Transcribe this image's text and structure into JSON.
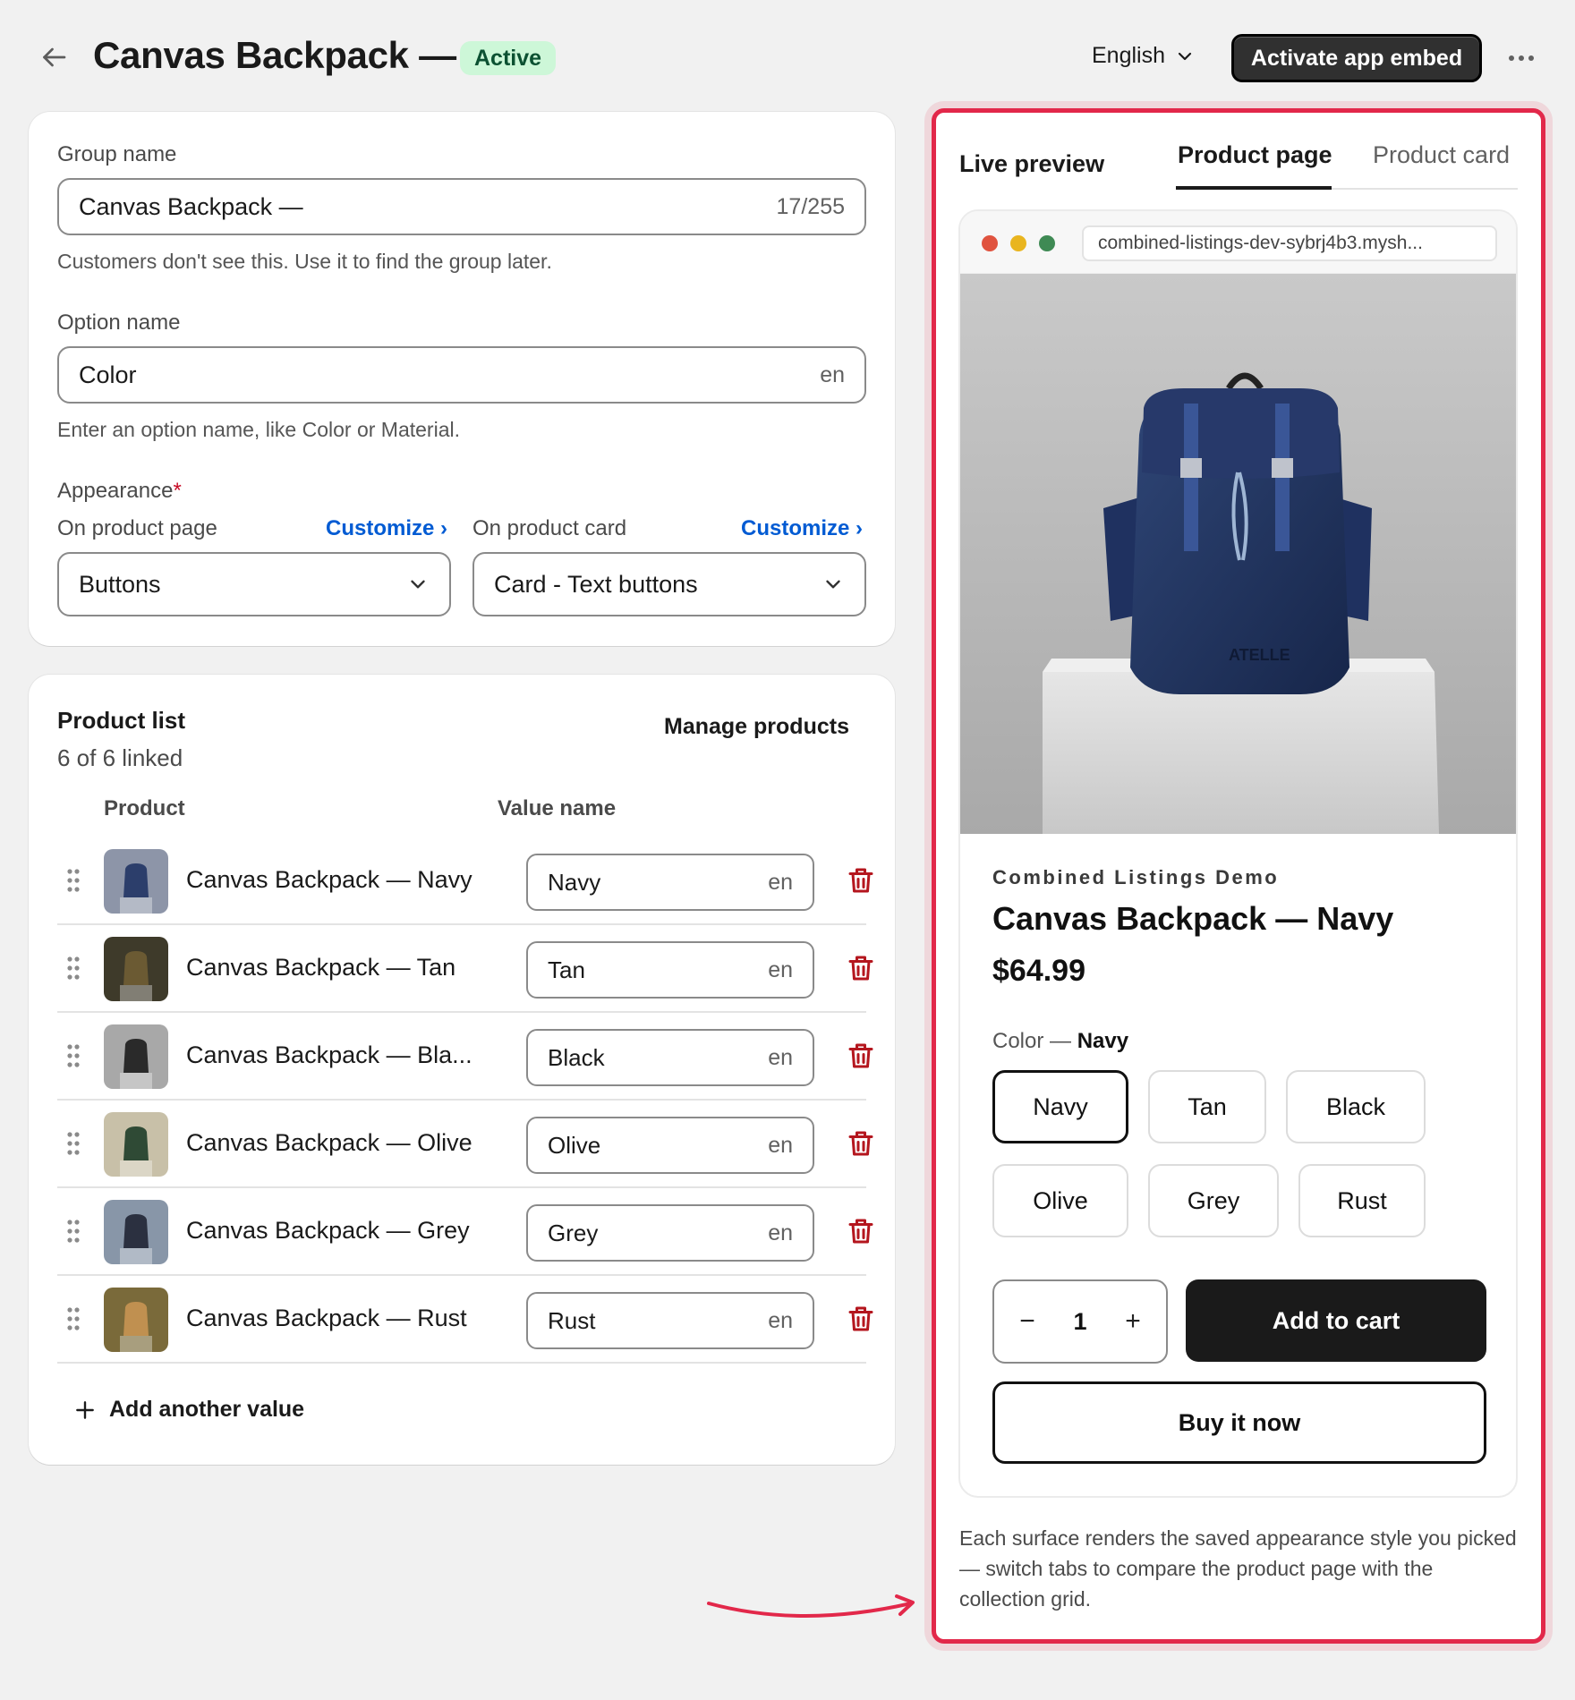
{
  "header": {
    "title": "Canvas Backpack —",
    "status": "Active",
    "language": "English",
    "embed_button": "Activate app embed"
  },
  "group": {
    "name_label": "Group name",
    "name_value": "Canvas Backpack —",
    "name_counter": "17/255",
    "name_help": "Customers don't see this. Use it to find the group later.",
    "option_label": "Option name",
    "option_value": "Color",
    "option_locale": "en",
    "option_help": "Enter an option name, like Color or Material.",
    "appearance_label": "Appearance",
    "appearance_required": "*",
    "product_page_label": "On product page",
    "product_card_label": "On product card",
    "customize_label": "Customize ›",
    "product_page_value": "Buttons",
    "product_card_value": "Card - Text buttons"
  },
  "product_list": {
    "title": "Product list",
    "subtitle": "6 of 6 linked",
    "manage": "Manage products",
    "col_product": "Product",
    "col_value": "Value name",
    "add_value": "Add another value",
    "items": [
      {
        "name": "Canvas Backpack — Navy",
        "value": "Navy",
        "locale": "en"
      },
      {
        "name": "Canvas Backpack — Tan",
        "value": "Tan",
        "locale": "en"
      },
      {
        "name": "Canvas Backpack — Bla...",
        "value": "Black",
        "locale": "en"
      },
      {
        "name": "Canvas Backpack — Olive",
        "value": "Olive",
        "locale": "en"
      },
      {
        "name": "Canvas Backpack — Grey",
        "value": "Grey",
        "locale": "en"
      },
      {
        "name": "Canvas Backpack — Rust",
        "value": "Rust",
        "locale": "en"
      }
    ]
  },
  "preview": {
    "title": "Live preview",
    "tabs": [
      "Product page",
      "Product card"
    ],
    "url": "combined-listings-dev-sybrj4b3.mysh...",
    "brand_watermark": "ATELLE",
    "vendor": "Combined Listings Demo",
    "product_title": "Canvas Backpack — Navy",
    "price": "$64.99",
    "option_name": "Color —",
    "option_selected": "Navy",
    "swatches": [
      "Navy",
      "Tan",
      "Black",
      "Olive",
      "Grey",
      "Rust"
    ],
    "qty_minus": "−",
    "qty_value": "1",
    "qty_plus": "+",
    "add_to_cart": "Add to cart",
    "buy_now": "Buy it now",
    "note": "Each surface renders the saved appearance style you picked — switch tabs to compare the product page with the collection grid."
  },
  "colors": {
    "accent_link": "#005bd3",
    "status_bg": "#cdf7d8",
    "highlight": "#e2284a",
    "delete": "#b4161e"
  }
}
